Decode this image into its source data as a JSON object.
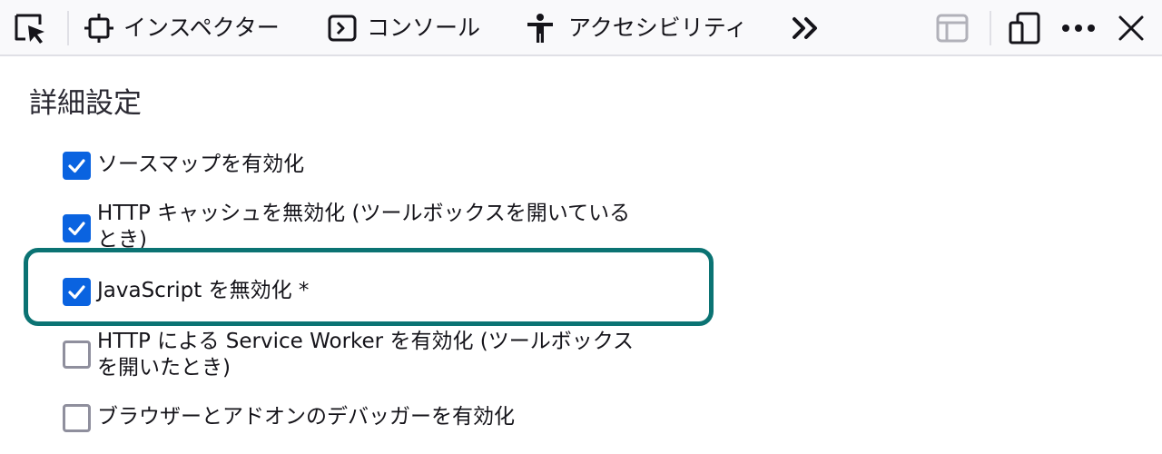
{
  "toolbar": {
    "picker_icon": "element-picker-icon",
    "tabs": [
      {
        "label": "インスペクター",
        "icon": "inspector-icon"
      },
      {
        "label": "コンソール",
        "icon": "console-icon"
      },
      {
        "label": "アクセシビリティ",
        "icon": "accessibility-icon"
      }
    ],
    "overflow_icon": "chevron-double-right-icon",
    "right_icons": [
      "dock-layout-icon",
      "responsive-design-icon",
      "more-options-icon",
      "close-icon"
    ]
  },
  "settings": {
    "section_title": "詳細設定",
    "options": [
      {
        "label": "ソースマップを有効化",
        "checked": true
      },
      {
        "label": "HTTP キャッシュを無効化 (ツールボックスを開いているとき)",
        "checked": true
      },
      {
        "label": "JavaScript を無効化 *",
        "checked": true,
        "highlighted": true
      },
      {
        "label": "HTTP による Service Worker を有効化 (ツールボックスを開いたとき)",
        "checked": false
      },
      {
        "label": "ブラウザーとアドオンのデバッガーを有効化",
        "checked": false
      }
    ]
  },
  "colors": {
    "checkbox_checked": "#0a63e0",
    "checkbox_unchecked_border": "#8f8f9d",
    "highlight_border": "#0b7373",
    "toolbar_bg": "#f9f9fb"
  }
}
